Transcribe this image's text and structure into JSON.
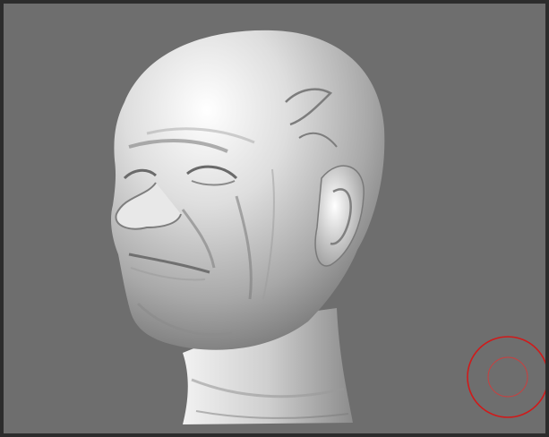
{
  "viewport": {
    "background_color": "#6e6e6e",
    "frame_color": "#2c2c2c"
  },
  "sculpt": {
    "icon": "sculpted-head-mesh",
    "material_color": "#c9c9c9"
  },
  "brush_cursor": {
    "icon": "brush-cursor-circle",
    "color": "#d01a1a"
  }
}
